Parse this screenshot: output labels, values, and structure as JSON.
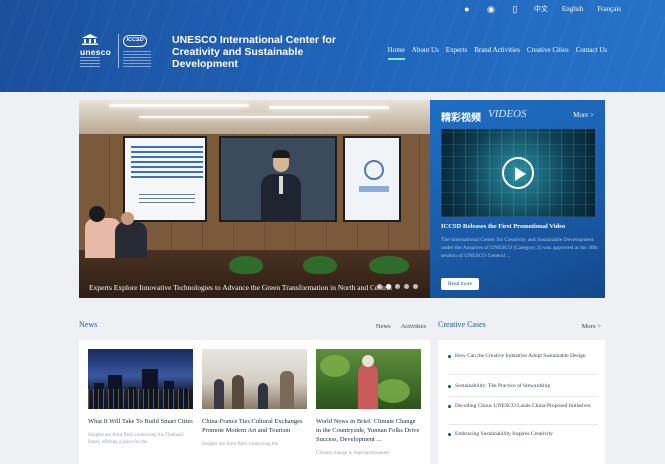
{
  "header": {
    "utility": {
      "icons": [
        "wechat-icon",
        "weibo-icon",
        "mobile-icon"
      ],
      "links": [
        "中文",
        "English",
        "Français"
      ]
    },
    "logos": {
      "unesco": "unesco",
      "iccsd": "ICCSD"
    },
    "title": "UNESCO International Center for Creativity and Sustainable Development",
    "nav": [
      {
        "label": "Home",
        "active": true
      },
      {
        "label": "About Us"
      },
      {
        "label": "Experts"
      },
      {
        "label": "Brand Activities"
      },
      {
        "label": "Creative Cities"
      },
      {
        "label": "Contact Us"
      }
    ],
    "accent_color": "#7fe0d4"
  },
  "hero": {
    "caption": "Experts Explore Innovative Technologies to Advance the Green Transformation in North and Central",
    "dots": 5,
    "active_dot": 2
  },
  "videos": {
    "title_cn": "精彩视频",
    "title_en": "VIDEOS",
    "more": "More >",
    "headline": "ICCSD Releases the First Promotional Video",
    "description": "The International Center for Creativity and Sustainable Development under the Auspices of UNESCO (Category 2) was approved at the 38th session of UNESCO General ...",
    "read_more": "Read more"
  },
  "news": {
    "title": "News",
    "tabs": [
      "News",
      "Activities"
    ],
    "cards": [
      {
        "title": "What It Will Take To Build Smart Cities",
        "desc": "Insights are from Paris connecting the Thematic Panel, offering a place for the"
      },
      {
        "title": "China-France Ties Cultural Exchanges Promote Modern Art and Tourism",
        "desc": "Insights are from Paris connecting the"
      },
      {
        "title": "World News in Brief: Climate Change in the Countryside, Yunnan Folks Drive Success, Development ...",
        "desc": "Climate change is disproportionately"
      }
    ]
  },
  "cases": {
    "title": "Creative Cases",
    "more": "More >",
    "items": [
      "How Can the Creative Industries Adopt Sustainable Design",
      "Sustainability: The Practice of Stewardship",
      "Decoding China: UNESCO Lauds China-Proposed Initiatives",
      "Embracing Sustainability Inspires Creativity"
    ]
  }
}
